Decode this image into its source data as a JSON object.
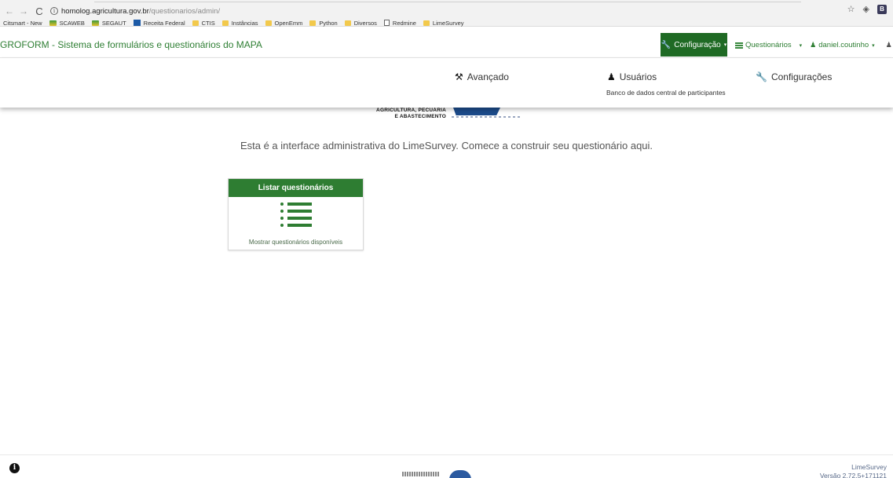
{
  "browser": {
    "back_glyph": "←",
    "forward_glyph": "→",
    "reload_glyph": "C",
    "info_glyph": "i",
    "url_domain": "homolog.agricultura.gov.br",
    "url_path": "/questionarios/admin/",
    "star_glyph": "☆",
    "ext_glyph": "◈",
    "ext_b": "B",
    "bookmarks": [
      {
        "label": "Citsmart - New",
        "icon": "none"
      },
      {
        "label": "SCAWEB",
        "icon": "green"
      },
      {
        "label": "SEGAUT",
        "icon": "green"
      },
      {
        "label": "Receita Federal",
        "icon": "blue"
      },
      {
        "label": "CTIS",
        "icon": "folder"
      },
      {
        "label": "Instâncias",
        "icon": "folder"
      },
      {
        "label": "OpenEmm",
        "icon": "folder"
      },
      {
        "label": "Python",
        "icon": "folder"
      },
      {
        "label": "Diversos",
        "icon": "folder"
      },
      {
        "label": "Redmine",
        "icon": "page"
      },
      {
        "label": "LimeSurvey",
        "icon": "folder"
      }
    ]
  },
  "navbar": {
    "brand": "GROFORM - Sistema de formulários e questionários do MAPA",
    "config_label": "Configuração",
    "questionarios_label": "Questionários",
    "user_label": "daniel.coutinho",
    "user_glyph": "♟",
    "bell_glyph": "♟",
    "caret": "▾"
  },
  "dropdown": {
    "avancado": {
      "label": "Avançado",
      "icon_glyph": "⚒"
    },
    "usuarios": {
      "label": "Usuários",
      "sub": "Banco de dados central de participantes",
      "icon_glyph": "♟"
    },
    "configuracoes": {
      "label": "Configurações",
      "icon_glyph": "🔧"
    }
  },
  "logo_peek": {
    "line1": "AGRICULTURA, PECUÁRIA",
    "line2": "E ABASTECIMENTO"
  },
  "main": {
    "welcome": "Esta é a interface administrativa do LimeSurvey. Comece a construir seu questionário aqui.",
    "panel": {
      "title": "Listar questionários",
      "description": "Mostrar questionários disponíveis"
    }
  },
  "footer": {
    "info_glyph": "i",
    "app": "LimeSurvey",
    "version": "Versão 2.72.5+171121"
  }
}
